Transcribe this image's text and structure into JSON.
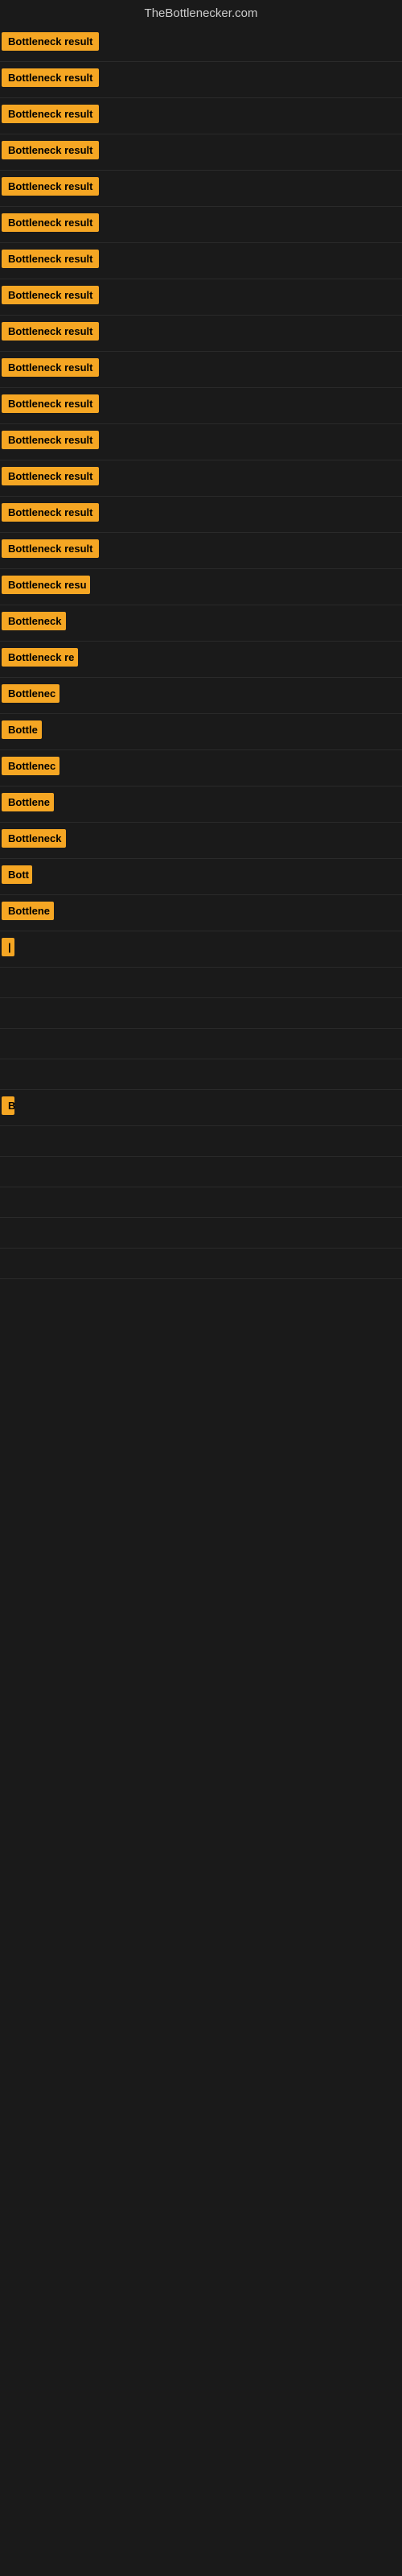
{
  "header": {
    "title": "TheBottlenecker.com"
  },
  "rows": [
    {
      "label": "Bottleneck result",
      "width": 130
    },
    {
      "label": "Bottleneck result",
      "width": 130
    },
    {
      "label": "Bottleneck result",
      "width": 130
    },
    {
      "label": "Bottleneck result",
      "width": 130
    },
    {
      "label": "Bottleneck result",
      "width": 130
    },
    {
      "label": "Bottleneck result",
      "width": 130
    },
    {
      "label": "Bottleneck result",
      "width": 130
    },
    {
      "label": "Bottleneck result",
      "width": 130
    },
    {
      "label": "Bottleneck result",
      "width": 130
    },
    {
      "label": "Bottleneck result",
      "width": 130
    },
    {
      "label": "Bottleneck result",
      "width": 130
    },
    {
      "label": "Bottleneck result",
      "width": 130
    },
    {
      "label": "Bottleneck result",
      "width": 130
    },
    {
      "label": "Bottleneck result",
      "width": 130
    },
    {
      "label": "Bottleneck result",
      "width": 130
    },
    {
      "label": "Bottleneck resu",
      "width": 110
    },
    {
      "label": "Bottleneck",
      "width": 80
    },
    {
      "label": "Bottleneck re",
      "width": 95
    },
    {
      "label": "Bottlenec",
      "width": 72
    },
    {
      "label": "Bottle",
      "width": 50
    },
    {
      "label": "Bottlenec",
      "width": 72
    },
    {
      "label": "Bottlene",
      "width": 65
    },
    {
      "label": "Bottleneck",
      "width": 80
    },
    {
      "label": "Bott",
      "width": 38
    },
    {
      "label": "Bottlene",
      "width": 65
    },
    {
      "label": "|",
      "width": 10
    },
    {
      "label": "",
      "width": 0
    },
    {
      "label": "",
      "width": 0
    },
    {
      "label": "",
      "width": 0
    },
    {
      "label": "",
      "width": 0
    },
    {
      "label": "B",
      "width": 14
    },
    {
      "label": "",
      "width": 0
    },
    {
      "label": "",
      "width": 0
    },
    {
      "label": "",
      "width": 0
    },
    {
      "label": "",
      "width": 0
    },
    {
      "label": "",
      "width": 0
    }
  ]
}
